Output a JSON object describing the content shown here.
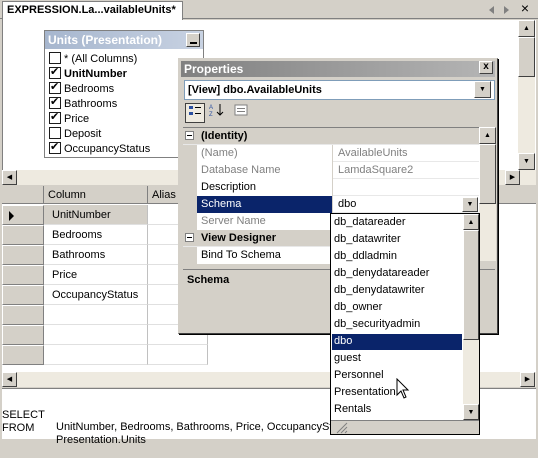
{
  "tab": {
    "title": "EXPRESSION.La...vailableUnits*"
  },
  "diagram": {
    "table_title": "Units (Presentation)",
    "columns": [
      {
        "label": "* (All Columns)",
        "checked": false,
        "bold": false
      },
      {
        "label": "UnitNumber",
        "checked": true,
        "bold": true
      },
      {
        "label": "Bedrooms",
        "checked": true,
        "bold": false
      },
      {
        "label": "Bathrooms",
        "checked": true,
        "bold": false
      },
      {
        "label": "Price",
        "checked": true,
        "bold": false
      },
      {
        "label": "Deposit",
        "checked": false,
        "bold": false
      },
      {
        "label": "OccupancyStatus",
        "checked": true,
        "bold": false
      }
    ]
  },
  "grid": {
    "headers": {
      "column": "Column",
      "alias": "Alias"
    },
    "rows": [
      "UnitNumber",
      "Bedrooms",
      "Bathrooms",
      "Price",
      "OccupancyStatus"
    ]
  },
  "sql": {
    "line1_kw": "SELECT",
    "line1_text": "UnitNumber, Bedrooms, Bathrooms, Price, OccupancySta",
    "line2_kw": "FROM",
    "line2_text": "Presentation.Units"
  },
  "properties": {
    "title": "Properties",
    "object": "[View] dbo.AvailableUnits",
    "close_glyph": "x",
    "categories": {
      "identity": "(Identity)",
      "view_designer": "View Designer"
    },
    "rows": {
      "name": {
        "label": "(Name)",
        "value": "AvailableUnits"
      },
      "database_name": {
        "label": "Database Name",
        "value": "LamdaSquare2"
      },
      "description": {
        "label": "Description",
        "value": ""
      },
      "schema": {
        "label": "Schema",
        "value": "dbo"
      },
      "server_name": {
        "label": "Server Name",
        "value": ""
      },
      "bind_to_schema": {
        "label": "Bind To Schema",
        "value": ""
      }
    },
    "description_title": "Schema"
  },
  "schema_dropdown": {
    "items": [
      "db_datareader",
      "db_datawriter",
      "db_ddladmin",
      "db_denydatareader",
      "db_denydatawriter",
      "db_owner",
      "db_securityadmin",
      "dbo",
      "guest",
      "Personnel",
      "Presentation",
      "Rentals"
    ],
    "selected": "dbo"
  },
  "icons": {
    "tab_nav_left": "chevron-left-icon",
    "tab_nav_right": "chevron-right-icon",
    "close": "close-icon",
    "dropdown": "chevron-down-icon",
    "categorized": "categorized-icon",
    "alphabetical": "alphabetical-icon",
    "property_pages": "property-pages-icon",
    "mouse_cursor": "mouse-pointer-icon"
  },
  "colors": {
    "selection": "#0a246a",
    "title_gradient": "#a6b6ce"
  }
}
